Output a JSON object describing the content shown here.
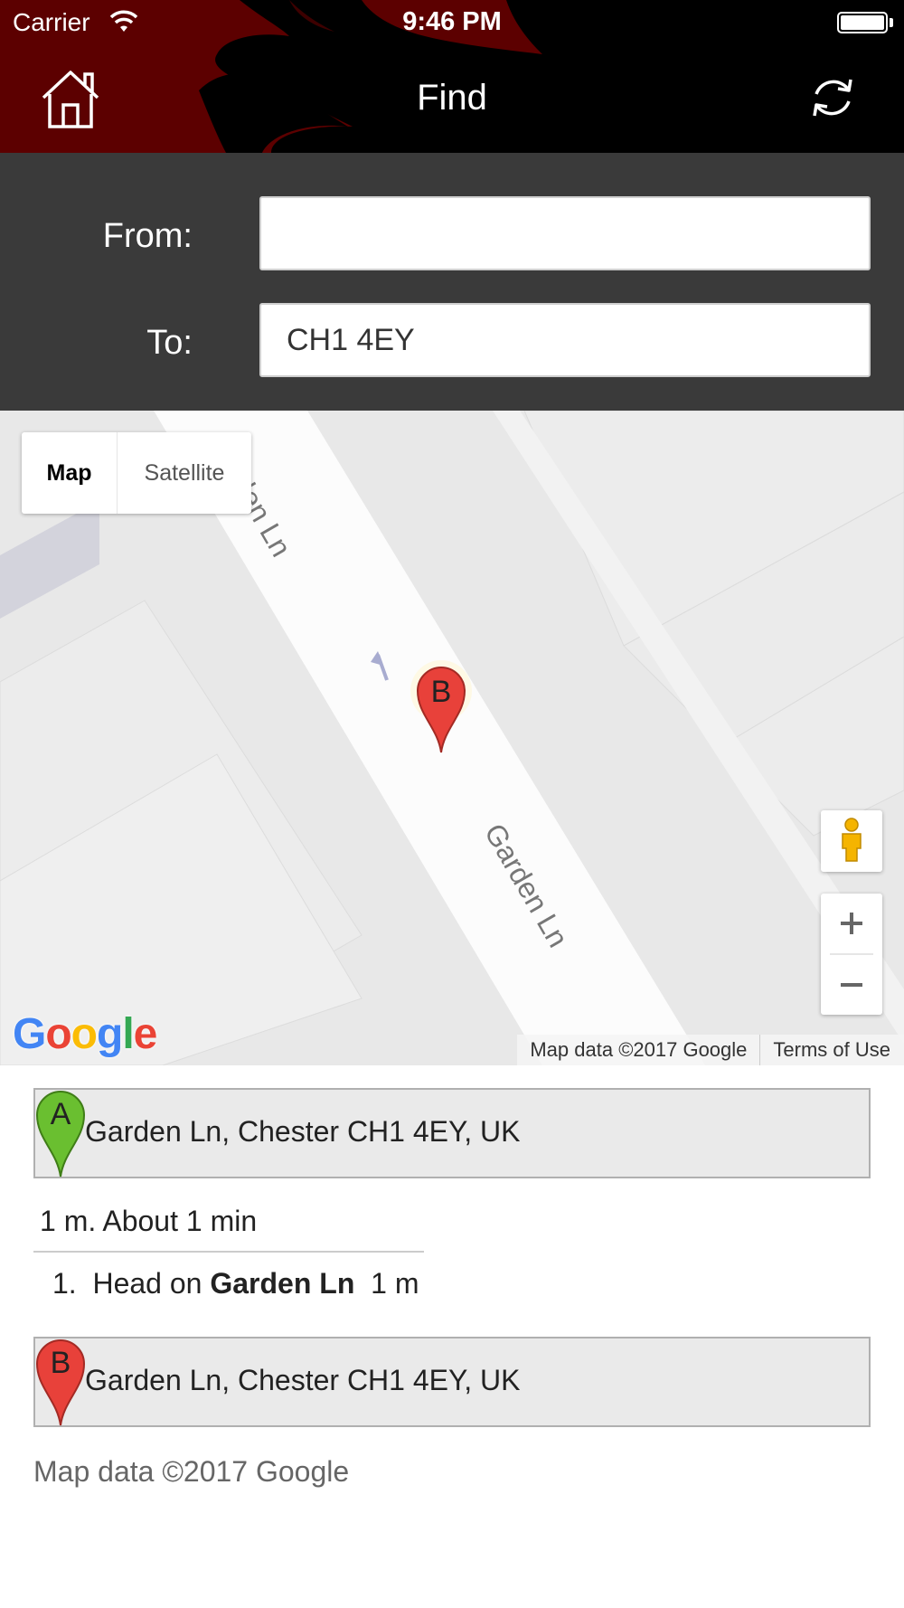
{
  "status_bar": {
    "carrier": "Carrier",
    "time": "9:46 PM",
    "icons": [
      "wifi-icon",
      "battery-icon"
    ]
  },
  "header": {
    "title": "Find",
    "left_icon": "home-icon",
    "right_icon": "refresh-icon",
    "colors": {
      "background": "#000000",
      "flame": "#5c0000"
    }
  },
  "form": {
    "from_label": "From:",
    "from_value": "",
    "to_label": "To:",
    "to_value": "CH1 4EY"
  },
  "map": {
    "map_type": {
      "map_label": "Map",
      "satellite_label": "Satellite",
      "selected": "Map"
    },
    "street_labels": [
      "rden Ln",
      "Garden Ln"
    ],
    "marker_letter": "B",
    "logo": "Google",
    "attribution": "Map data ©2017 Google",
    "terms": "Terms of Use",
    "controls": [
      "pegman-icon",
      "zoom-in-icon",
      "zoom-out-icon"
    ]
  },
  "directions": {
    "start": {
      "letter": "A",
      "address": "Garden Ln, Chester CH1 4EY, UK",
      "color": "#6abf30"
    },
    "summary": "1 m. About 1 min",
    "steps": [
      {
        "number": "1.",
        "prefix": "Head on",
        "street": "Garden Ln",
        "distance": "1 m"
      }
    ],
    "end": {
      "letter": "B",
      "address": "Garden Ln, Chester CH1 4EY, UK",
      "color": "#e8413a"
    },
    "footer": "Map data ©2017 Google"
  }
}
